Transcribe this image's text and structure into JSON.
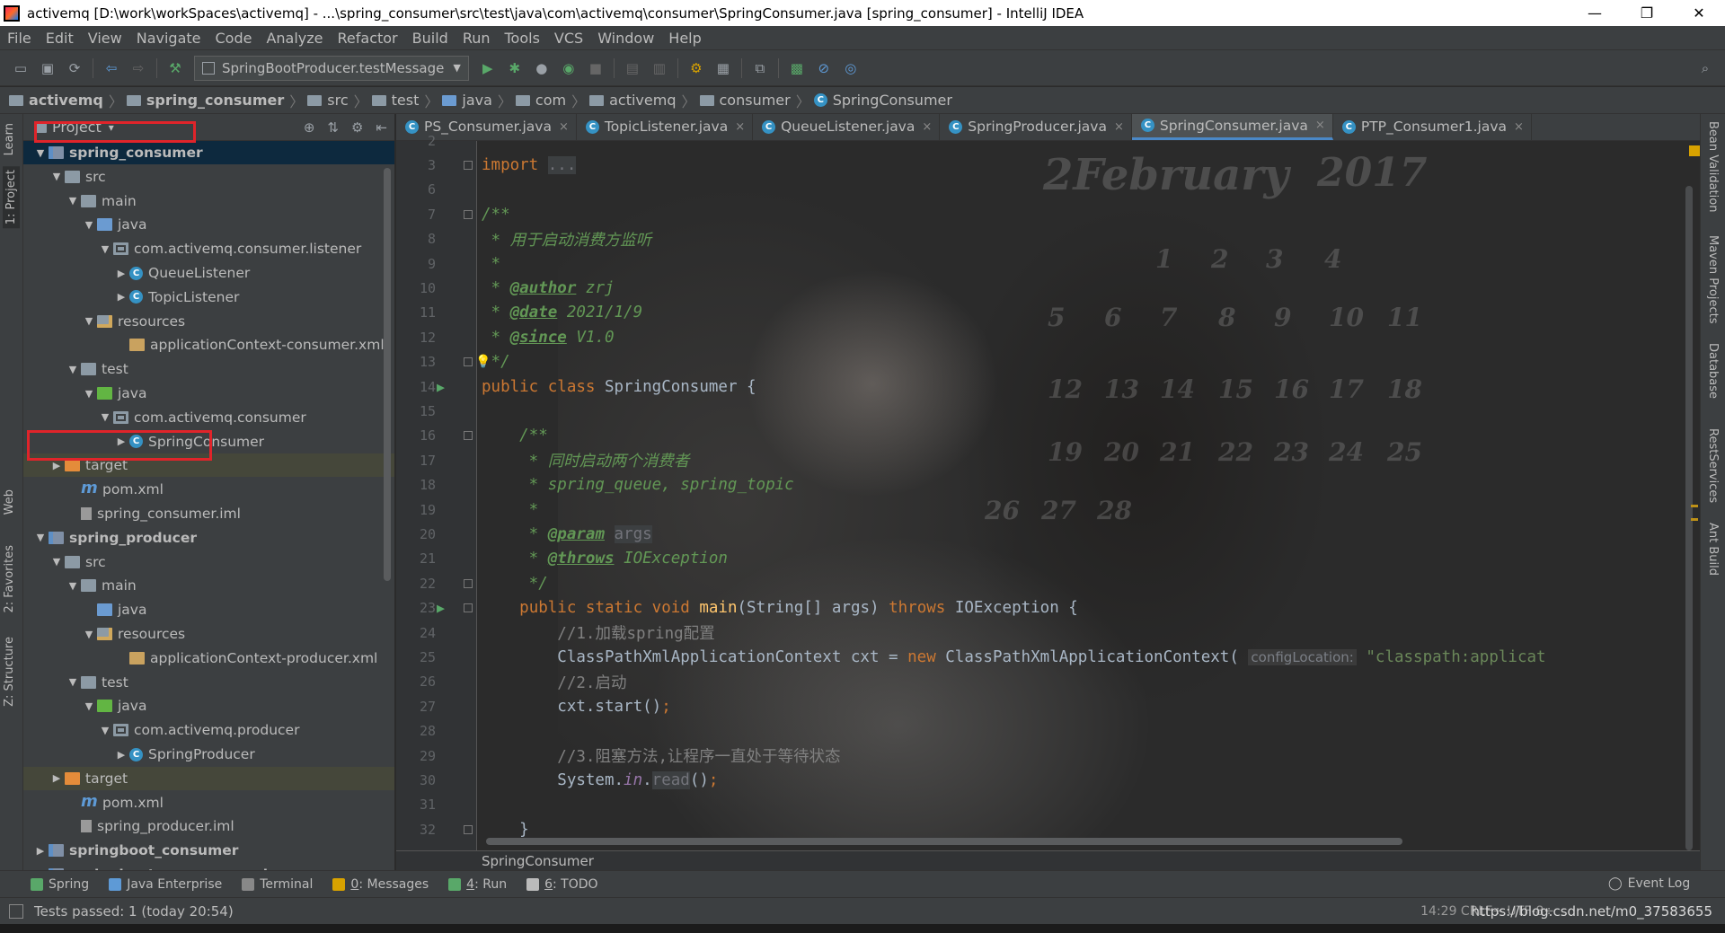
{
  "window": {
    "title": "activemq [D:\\work\\workSpaces\\activemq] - ...\\spring_consumer\\src\\test\\java\\com\\activemq\\consumer\\SpringConsumer.java [spring_consumer] - IntelliJ IDEA",
    "minimize": "—",
    "restore": "❐",
    "close": "✕"
  },
  "menu": [
    "File",
    "Edit",
    "View",
    "Navigate",
    "Code",
    "Analyze",
    "Refactor",
    "Build",
    "Run",
    "Tools",
    "VCS",
    "Window",
    "Help"
  ],
  "toolbar": {
    "run_config": "SpringBootProducer.testMessage",
    "dropdown_arrow": "▼"
  },
  "breadcrumbs": [
    "activemq",
    "spring_consumer",
    "src",
    "test",
    "java",
    "com",
    "activemq",
    "consumer",
    "SpringConsumer"
  ],
  "left_strip": {
    "learn": "Learn",
    "project": "1: Project",
    "web": "Web",
    "favorites": "2: Favorites",
    "structure": "Z: Structure"
  },
  "project_panel": {
    "title": "Project",
    "dropdown": "▾"
  },
  "tree": [
    {
      "text": "spring_consumer",
      "bold": true,
      "depth": 1,
      "arrow": "▼",
      "icon": "module",
      "selected": true
    },
    {
      "text": "src",
      "depth": 2,
      "arrow": "▼",
      "icon": "folder"
    },
    {
      "text": "main",
      "depth": 3,
      "arrow": "▼",
      "icon": "folder"
    },
    {
      "text": "java",
      "depth": 4,
      "arrow": "▼",
      "icon": "src-folder"
    },
    {
      "text": "com.activemq.consumer.listener",
      "depth": 5,
      "arrow": "▼",
      "icon": "pkg"
    },
    {
      "text": "QueueListener",
      "depth": 6,
      "arrow": "▶",
      "icon": "cls"
    },
    {
      "text": "TopicListener",
      "depth": 6,
      "arrow": "▶",
      "icon": "cls"
    },
    {
      "text": "resources",
      "depth": 4,
      "arrow": "▼",
      "icon": "res-folder"
    },
    {
      "text": "applicationContext-consumer.xml",
      "depth": 6,
      "arrow": "",
      "icon": "xml"
    },
    {
      "text": "test",
      "depth": 3,
      "arrow": "▼",
      "icon": "folder"
    },
    {
      "text": "java",
      "depth": 4,
      "arrow": "▼",
      "icon": "test-folder"
    },
    {
      "text": "com.activemq.consumer",
      "depth": 5,
      "arrow": "▼",
      "icon": "pkg"
    },
    {
      "text": "SpringConsumer",
      "depth": 6,
      "arrow": "▶",
      "icon": "cls"
    },
    {
      "text": "target",
      "depth": 2,
      "arrow": "▶",
      "icon": "target-folder",
      "muted": true
    },
    {
      "text": "pom.xml",
      "depth": 3,
      "arrow": "",
      "icon": "maven"
    },
    {
      "text": "spring_consumer.iml",
      "depth": 3,
      "arrow": "",
      "icon": "iml"
    },
    {
      "text": "spring_producer",
      "bold": true,
      "depth": 1,
      "arrow": "▼",
      "icon": "module"
    },
    {
      "text": "src",
      "depth": 2,
      "arrow": "▼",
      "icon": "folder"
    },
    {
      "text": "main",
      "depth": 3,
      "arrow": "▼",
      "icon": "folder"
    },
    {
      "text": "java",
      "depth": 4,
      "arrow": "",
      "icon": "src-folder"
    },
    {
      "text": "resources",
      "depth": 4,
      "arrow": "▼",
      "icon": "res-folder"
    },
    {
      "text": "applicationContext-producer.xml",
      "depth": 6,
      "arrow": "",
      "icon": "xml"
    },
    {
      "text": "test",
      "depth": 3,
      "arrow": "▼",
      "icon": "folder"
    },
    {
      "text": "java",
      "depth": 4,
      "arrow": "▼",
      "icon": "test-folder"
    },
    {
      "text": "com.activemq.producer",
      "depth": 5,
      "arrow": "▼",
      "icon": "pkg"
    },
    {
      "text": "SpringProducer",
      "depth": 6,
      "arrow": "▶",
      "icon": "cls"
    },
    {
      "text": "target",
      "depth": 2,
      "arrow": "▶",
      "icon": "target-folder",
      "muted": true
    },
    {
      "text": "pom.xml",
      "depth": 3,
      "arrow": "",
      "icon": "maven"
    },
    {
      "text": "spring_producer.iml",
      "depth": 3,
      "arrow": "",
      "icon": "iml"
    },
    {
      "text": "springboot_consumer",
      "bold": true,
      "depth": 1,
      "arrow": "▶",
      "icon": "module"
    },
    {
      "text": "springboot_consumer_ack",
      "bold": true,
      "depth": 1,
      "arrow": "▶",
      "icon": "module"
    }
  ],
  "tabs": [
    {
      "label": "PS_Consumer.java",
      "active": false
    },
    {
      "label": "TopicListener.java",
      "active": false
    },
    {
      "label": "QueueListener.java",
      "active": false
    },
    {
      "label": "SpringProducer.java",
      "active": false
    },
    {
      "label": "SpringConsumer.java",
      "active": true
    },
    {
      "label": "PTP_Consumer1.java",
      "active": false
    }
  ],
  "tab_close": "×",
  "code": {
    "lines": [
      {
        "n": "2",
        "html": ""
      },
      {
        "n": "3",
        "html": "<span class=\"kw\">import</span> <span class=\"unused\">...</span>"
      },
      {
        "n": "6",
        "html": ""
      },
      {
        "n": "7",
        "html": "<span class=\"doc\">/**</span>"
      },
      {
        "n": "8",
        "html": "<span class=\"doc\"> * 用于启动消费方监听</span>"
      },
      {
        "n": "9",
        "html": "<span class=\"doc\"> *</span>"
      },
      {
        "n": "10",
        "html": "<span class=\"doc\"> * </span><span class=\"doctag\">@author</span><span class=\"doc\"> zrj</span>"
      },
      {
        "n": "11",
        "html": "<span class=\"doc\"> * </span><span class=\"doctag\">@date</span><span class=\"doc\"> 2021/1/9</span>"
      },
      {
        "n": "12",
        "html": "<span class=\"doc\"> * </span><span class=\"doctag\">@since</span><span class=\"doc\"> V1.0</span>"
      },
      {
        "n": "13",
        "html": "<span class=\"doc\"> */</span>"
      },
      {
        "n": "14",
        "html": "<span class=\"kw\">public class</span> SpringConsumer {"
      },
      {
        "n": "15",
        "html": ""
      },
      {
        "n": "16",
        "html": "    <span class=\"doc\">/**</span>"
      },
      {
        "n": "17",
        "html": "<span class=\"doc\">     * 同时启动两个消费者</span>"
      },
      {
        "n": "18",
        "html": "<span class=\"doc\">     * spring_queue, spring_topic</span>"
      },
      {
        "n": "19",
        "html": "<span class=\"doc\">     *</span>"
      },
      {
        "n": "20",
        "html": "<span class=\"doc\">     * </span><span class=\"doctag\">@param</span><span class=\"doc\"> </span><span class=\"unused\">args</span>"
      },
      {
        "n": "21",
        "html": "<span class=\"doc\">     * </span><span class=\"doctag\">@throws</span><span class=\"doc\"> IOException</span>"
      },
      {
        "n": "22",
        "html": "<span class=\"doc\">     */</span>"
      },
      {
        "n": "23",
        "html": "    <span class=\"kw\">public static void</span> <span class=\"fn\">main</span>(String[] args) <span class=\"kw\">throws</span> IOException {"
      },
      {
        "n": "24",
        "html": "        <span class=\"cmt\">//1.加载spring配置</span>"
      },
      {
        "n": "25",
        "html": "        ClassPathXmlApplicationContext cxt = <span class=\"kw\">new</span> ClassPathXmlApplicationContext( <span class=\"hint\">configLocation:</span> <span class=\"str\">\"classpath:applicat</span>"
      },
      {
        "n": "26",
        "html": "        <span class=\"cmt\">//2.启动</span>"
      },
      {
        "n": "27",
        "html": "        cxt.start()<span class=\"kw\">;</span>"
      },
      {
        "n": "28",
        "html": ""
      },
      {
        "n": "29",
        "html": "        <span class=\"cmt\">//3.阻塞方法,让程序一直处于等待状态</span>"
      },
      {
        "n": "30",
        "html": "        System.<span class=\"static\">in</span>.<span class=\"unused\">read</span>()<span class=\"kw\">;</span>"
      },
      {
        "n": "31",
        "html": ""
      },
      {
        "n": "32",
        "html": "    }"
      }
    ],
    "footer": "SpringConsumer"
  },
  "calendar": {
    "month": "2February",
    "year": "2017",
    "numbers": [
      "1",
      "2",
      "3",
      "4",
      "5",
      "6",
      "7",
      "8",
      "9",
      "10",
      "11",
      "12",
      "13",
      "14",
      "15",
      "16",
      "17",
      "18",
      "19",
      "20",
      "21",
      "22",
      "23",
      "24",
      "25",
      "26",
      "27",
      "28"
    ]
  },
  "right_strip": {
    "bean_validation": "Bean Validation",
    "maven": "Maven Projects",
    "database": "Database",
    "rest": "RestServices",
    "ant": "Ant Build"
  },
  "bottom_tools": [
    {
      "label": "Spring",
      "key": ""
    },
    {
      "label": "Java Enterprise",
      "key": ""
    },
    {
      "label": "Terminal",
      "key": ""
    },
    {
      "label": ": Messages",
      "key": "0"
    },
    {
      "label": ": Run",
      "key": "4"
    },
    {
      "label": ": TODO",
      "key": "6"
    }
  ],
  "event_log": "Event Log",
  "status": {
    "text": "Tests passed: 1 (today 20:54)",
    "position": "14:29  CRLF÷  UTF-8÷",
    "url": "https://blog.csdn.net/m0_37583655"
  },
  "colors": {
    "highlight": "#e0242a",
    "accent": "#4a88c7",
    "background": "#2b2b2b",
    "panel": "#3c3f41"
  }
}
